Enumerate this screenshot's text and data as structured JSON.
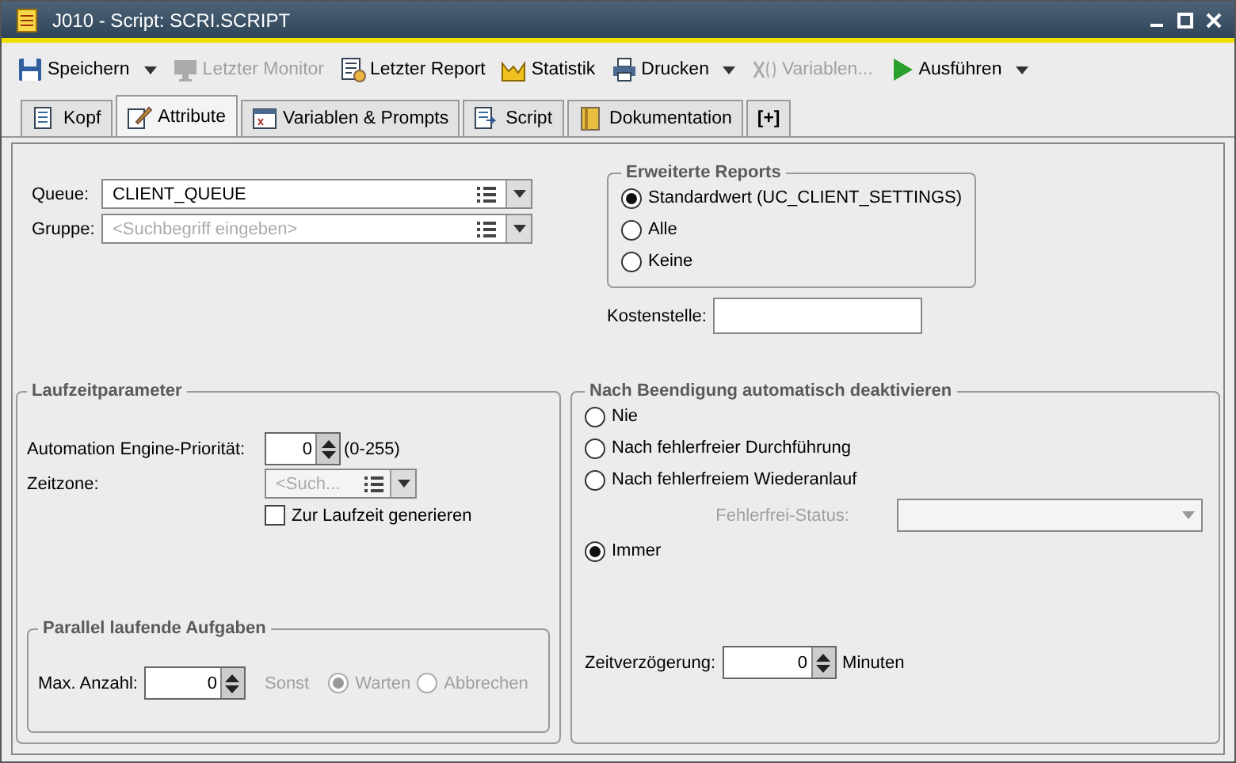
{
  "window": {
    "title": "J010 - Script: SCRI.SCRIPT"
  },
  "toolbar": [
    {
      "label": "Speichern",
      "disabled": false,
      "dropdown": true
    },
    {
      "label": "Letzter Monitor",
      "disabled": true,
      "dropdown": false
    },
    {
      "label": "Letzter Report",
      "disabled": false,
      "dropdown": false
    },
    {
      "label": "Statistik",
      "disabled": false,
      "dropdown": false
    },
    {
      "label": "Drucken",
      "disabled": false,
      "dropdown": true
    },
    {
      "label": "Variablen...",
      "disabled": true,
      "dropdown": false
    },
    {
      "label": "Ausführen",
      "disabled": false,
      "dropdown": true
    }
  ],
  "tabs": [
    {
      "label": "Kopf",
      "selected": false
    },
    {
      "label": "Attribute",
      "selected": true
    },
    {
      "label": "Variablen & Prompts",
      "selected": false
    },
    {
      "label": "Script",
      "selected": false
    },
    {
      "label": "Dokumentation",
      "selected": false
    },
    {
      "label": "[+]",
      "selected": false
    }
  ],
  "queue": {
    "label": "Queue:",
    "value": "CLIENT_QUEUE"
  },
  "gruppe": {
    "label": "Gruppe:",
    "placeholder": "<Suchbegriff eingeben>"
  },
  "erweiterte_reports": {
    "title": "Erweiterte Reports",
    "options": [
      {
        "label": "Standardwert (UC_CLIENT_SETTINGS)",
        "selected": true
      },
      {
        "label": "Alle",
        "selected": false
      },
      {
        "label": "Keine",
        "selected": false
      }
    ]
  },
  "kostenstelle": {
    "label": "Kostenstelle:"
  },
  "laufzeitparameter": {
    "title": "Laufzeitparameter",
    "prioritaet": {
      "label": "Automation Engine-Priorität:",
      "value": "0",
      "range": "(0-255)"
    },
    "zeitzone": {
      "label": "Zeitzone:",
      "placeholder": "<Such..."
    },
    "generieren": {
      "label": "Zur Laufzeit generieren",
      "checked": false
    }
  },
  "parallel": {
    "title": "Parallel laufende Aufgaben",
    "max_label": "Max. Anzahl:",
    "max_value": "0",
    "sonst": "Sonst",
    "options": [
      {
        "label": "Warten",
        "selected": true
      },
      {
        "label": "Abbrechen",
        "selected": false
      }
    ]
  },
  "deaktivieren": {
    "title": "Nach Beendigung automatisch deaktivieren",
    "options": [
      {
        "label": "Nie",
        "selected": false
      },
      {
        "label": "Nach fehlerfreier Durchführung",
        "selected": false
      },
      {
        "label": "Nach fehlerfreiem Wiederanlauf",
        "selected": false
      },
      {
        "label": "Immer",
        "selected": true
      }
    ],
    "status_label": "Fehlerfrei-Status:",
    "delay_label": "Zeitverzögerung:",
    "delay_value": "0",
    "delay_unit": "Minuten"
  }
}
